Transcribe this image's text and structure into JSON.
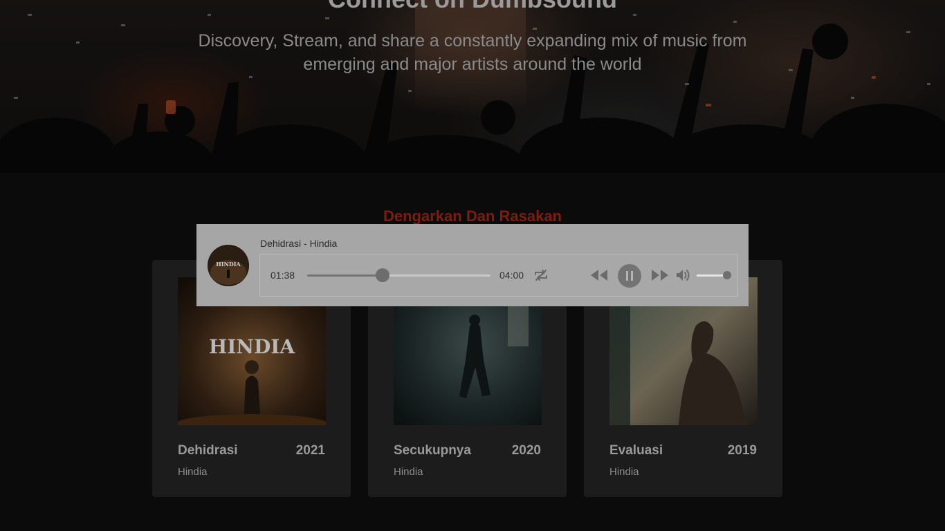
{
  "hero": {
    "title": "Connect on Dumbsound",
    "subtitle": "Discovery, Stream, and share a constantly expanding mix of music from emerging and major artists around the world"
  },
  "section": {
    "title": "Dengarkan Dan Rasakan"
  },
  "albums": [
    {
      "title": "Dehidrasi",
      "year": "2021",
      "artist": "Hindia",
      "cover_text": "HINDIA"
    },
    {
      "title": "Secukupnya",
      "year": "2020",
      "artist": "Hindia"
    },
    {
      "title": "Evaluasi",
      "year": "2019",
      "artist": "Hindia"
    }
  ],
  "player": {
    "now_playing": "Dehidrasi - Hindia",
    "thumb_text": "HINDIA",
    "current_time": "01:38",
    "total_time": "04:00",
    "progress": 0.41,
    "volume": 1.0,
    "state": "playing",
    "icons": [
      "repeat-icon",
      "rewind-icon",
      "pause-icon",
      "fast-forward-icon",
      "volume-icon"
    ]
  },
  "colors": {
    "accent": "#7c1d0f",
    "player_bg": "#a6a6a6",
    "card_bg": "#1c1c1c",
    "page_bg": "#0b0b0b"
  }
}
